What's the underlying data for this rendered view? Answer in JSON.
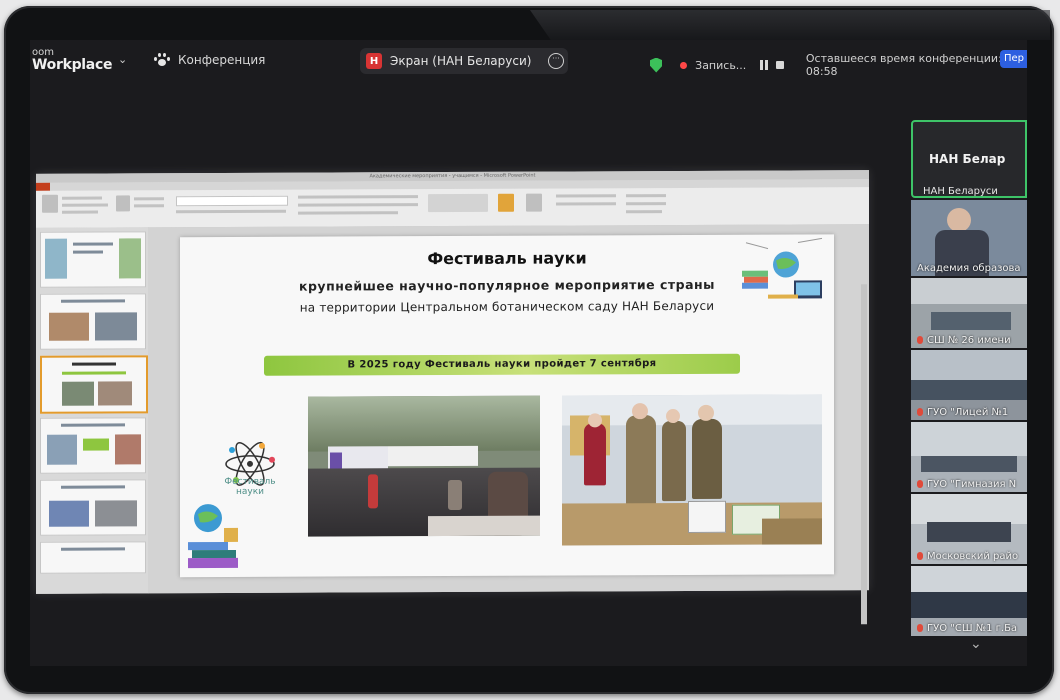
{
  "topbar": {
    "brand_line1": "oom",
    "brand_line2": "Workplace",
    "brand_chevron": "⌄",
    "conference_label": "Конференция",
    "share_badge": "Н",
    "share_label": "Экран (НАН Беларуси)",
    "more": "···",
    "record_label": "Запись...",
    "remaining_time": "Оставшееся время конференции: 08:58",
    "per_button": "Пер"
  },
  "powerpoint": {
    "window_title": "Академические мероприятия - учащимся - Microsoft PowerPoint"
  },
  "slide": {
    "title": "Фестиваль науки",
    "subtitle": "крупнейшее научно-популярное мероприятие страны",
    "subtitle2": "на территории Центральном ботаническом саду НАН Беларуси",
    "banner": "В 2025 году Фестиваль науки пройдет 7 сентября",
    "logo_text_1": "Фестиваль",
    "logo_text_2": "науки"
  },
  "participants": {
    "active_name": "НАН Белар",
    "active_label": "НАН Беларуси",
    "tiles": [
      {
        "label": "Академия образова"
      },
      {
        "label": "СШ № 26 имени"
      },
      {
        "label": "ГУО \"Лицей №1"
      },
      {
        "label": "ГУО \"Гимназия N"
      },
      {
        "label": "Московский райо"
      },
      {
        "label": "ГУО \"СШ №1 г.Ба"
      }
    ]
  },
  "colors": {
    "accent_green": "#3ec468",
    "record_red": "#ff4747",
    "banner_green": "#8ec63f",
    "per_blue": "#2d5fe0"
  }
}
